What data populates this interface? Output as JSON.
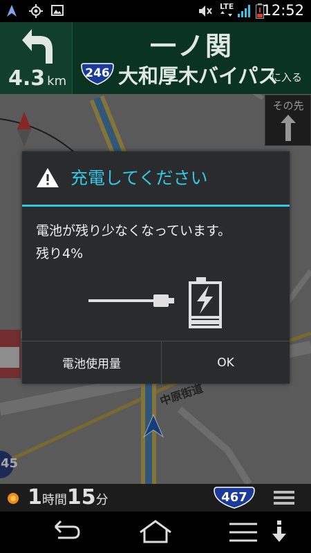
{
  "status_bar": {
    "icons_left": [
      "navigation-arrow-icon",
      "gps-icon",
      "image-icon"
    ],
    "icons_right": [
      "volume-mute-icon",
      "lte-icon",
      "signal-icon",
      "battery-low-icon"
    ],
    "network": "LTE",
    "time": "12:52"
  },
  "nav_header": {
    "distance_value": "4.3",
    "distance_unit": "km",
    "destination": "一ノ関",
    "route_number": "246",
    "road_name": "大和厚木バイパス",
    "road_suffix": "に入る",
    "next_label": "その先"
  },
  "map": {
    "street_label": "中原街道",
    "edge_route_number": "45"
  },
  "dialog": {
    "title": "充電してください",
    "message_line1": "電池が残り少なくなっています。",
    "message_line2": "残り4%",
    "battery_level_percent": 4,
    "buttons": {
      "usage": "電池使用量",
      "ok": "OK"
    },
    "accent_color": "#35c6e6"
  },
  "info_bar": {
    "eta_hours": "1",
    "eta_hours_unit": "時間",
    "eta_minutes": "15",
    "eta_minutes_unit": "分",
    "route_number": "467"
  },
  "system_nav": {
    "buttons": [
      "back-icon",
      "home-icon",
      "menu-icon",
      "download-icon"
    ]
  }
}
